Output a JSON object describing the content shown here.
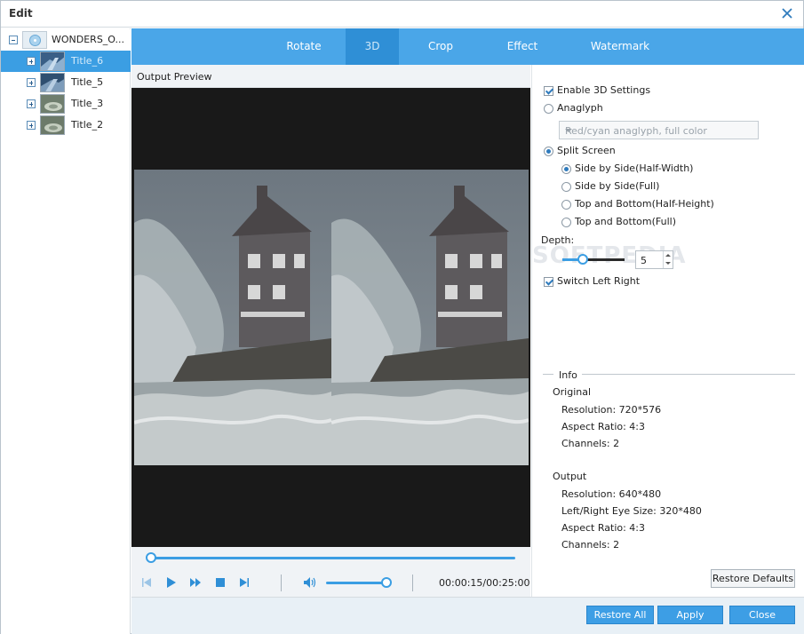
{
  "window": {
    "title": "Edit"
  },
  "tree": {
    "root_label": "WONDERS_O...",
    "titles": [
      {
        "label": "Title_6"
      },
      {
        "label": "Title_5"
      },
      {
        "label": "Title_3"
      },
      {
        "label": "Title_2"
      }
    ]
  },
  "tabs": [
    {
      "label": "Rotate"
    },
    {
      "label": "3D"
    },
    {
      "label": "Crop"
    },
    {
      "label": "Effect"
    },
    {
      "label": "Watermark"
    }
  ],
  "preview": {
    "label": "Output Preview",
    "timecode": "00:00:15/00:25:00",
    "seek_progress": 0,
    "volume": 0.9
  },
  "settings": {
    "enable_3d": "Enable 3D Settings",
    "anaglyph": "Anaglyph",
    "anaglyph_option": "Red/cyan anaglyph, full color",
    "split_screen": "Split Screen",
    "split_options": [
      {
        "label": "Side by Side(Half-Width)"
      },
      {
        "label": "Side by Side(Full)"
      },
      {
        "label": "Top and Bottom(Half-Height)"
      },
      {
        "label": "Top and Bottom(Full)"
      }
    ],
    "depth_label": "Depth:",
    "depth_value": "5",
    "switch_left_right": "Switch Left Right"
  },
  "info": {
    "heading": "Info",
    "original_heading": "Original",
    "original": [
      "Resolution: 720*576",
      "Aspect Ratio: 4:3",
      "Channels: 2"
    ],
    "output_heading": "Output",
    "output": [
      "Resolution: 640*480",
      "Left/Right Eye Size: 320*480",
      "Aspect Ratio: 4:3",
      "Channels: 2"
    ]
  },
  "watermark_text": "SOFTPEDIA",
  "buttons": {
    "restore_defaults": "Restore Defaults",
    "restore_all": "Restore All",
    "apply": "Apply",
    "close": "Close"
  },
  "colors": {
    "accent": "#3b9ee3",
    "tab_bar": "#4aa6e8"
  }
}
